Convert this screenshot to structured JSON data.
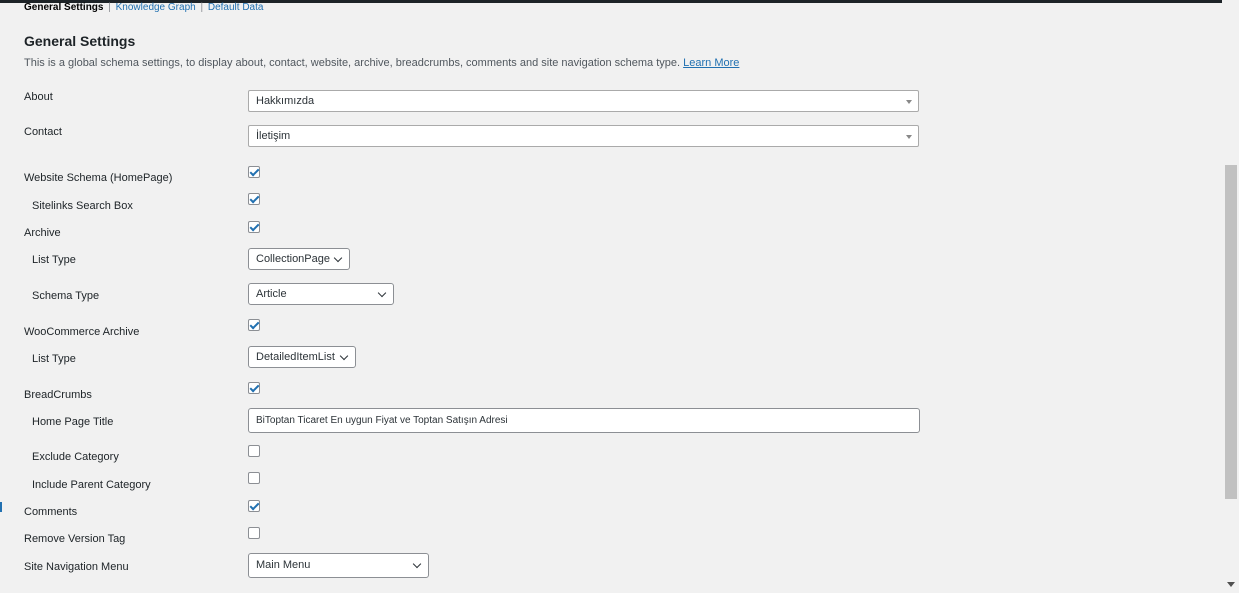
{
  "tabs": {
    "current": "General Settings",
    "separator": "|",
    "items": [
      "Knowledge Graph",
      "Default Data"
    ]
  },
  "heading": "General Settings",
  "description": "This is a global schema settings, to display about, contact, website, archive, breadcrumbs, comments and site navigation schema type.",
  "learn_more": "Learn More",
  "fields": {
    "about": {
      "label": "About",
      "value": "Hakkımızda"
    },
    "contact": {
      "label": "Contact",
      "value": "İletişim"
    },
    "website_schema": {
      "label": "Website Schema (HomePage)",
      "checked": true
    },
    "sitelinks": {
      "label": "Sitelinks Search Box",
      "checked": true
    },
    "archive": {
      "label": "Archive",
      "checked": true
    },
    "archive_list_type": {
      "label": "List Type",
      "value": "CollectionPage"
    },
    "schema_type": {
      "label": "Schema Type",
      "value": "Article"
    },
    "woo_archive": {
      "label": "WooCommerce Archive",
      "checked": true
    },
    "woo_list_type": {
      "label": "List Type",
      "value": "DetailedItemList"
    },
    "breadcrumbs": {
      "label": "BreadCrumbs",
      "checked": true
    },
    "home_page_title": {
      "label": "Home Page Title",
      "value": "BiToptan Ticaret En uygun Fiyat ve Toptan Satışın Adresi"
    },
    "exclude_category": {
      "label": "Exclude Category",
      "checked": false
    },
    "include_parent": {
      "label": "Include Parent Category",
      "checked": false
    },
    "comments": {
      "label": "Comments",
      "checked": true
    },
    "remove_version": {
      "label": "Remove Version Tag",
      "checked": false
    },
    "site_nav": {
      "label": "Site Navigation Menu",
      "value": "Main Menu"
    }
  }
}
